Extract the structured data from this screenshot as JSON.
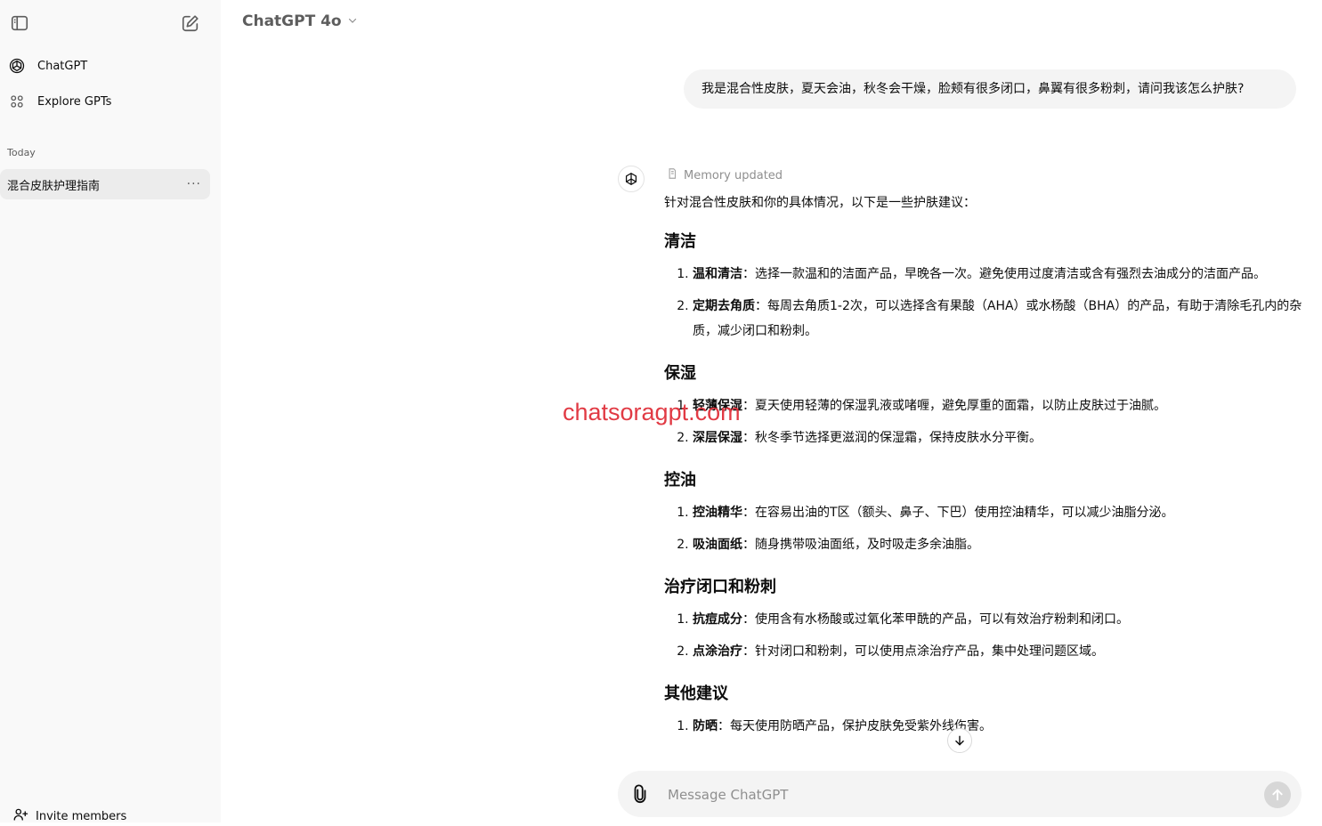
{
  "sidebar": {
    "toggle_icon": "sidebar-toggle-icon",
    "new_chat_icon": "new-chat-icon",
    "nav": [
      {
        "label": "ChatGPT",
        "icon": "openai-logo-icon"
      },
      {
        "label": "Explore GPTs",
        "icon": "grid-icon"
      }
    ],
    "section": "Today",
    "history": [
      {
        "title": "混合皮肤护理指南",
        "menu": "···"
      }
    ],
    "invite": "Invite members"
  },
  "header": {
    "model": "ChatGPT 4o"
  },
  "conversation": {
    "user_message": "我是混合性皮肤，夏天会油，秋冬会干燥，脸颊有很多闭口，鼻翼有很多粉刺，请问我该怎么护肤?",
    "memory_status": "Memory updated",
    "intro": "针对混合性皮肤和你的具体情况，以下是一些护肤建议：",
    "sections": [
      {
        "heading": "清洁",
        "items": [
          {
            "term": "温和清洁",
            "text": "：选择一款温和的洁面产品，早晚各一次。避免使用过度清洁或含有强烈去油成分的洁面产品。"
          },
          {
            "term": "定期去角质",
            "text": "：每周去角质1-2次，可以选择含有果酸（AHA）或水杨酸（BHA）的产品，有助于清除毛孔内的杂质，减少闭口和粉刺。"
          }
        ]
      },
      {
        "heading": "保湿",
        "items": [
          {
            "term": "轻薄保湿",
            "text": "：夏天使用轻薄的保湿乳液或啫喱，避免厚重的面霜，以防止皮肤过于油腻。"
          },
          {
            "term": "深层保湿",
            "text": "：秋冬季节选择更滋润的保湿霜，保持皮肤水分平衡。"
          }
        ]
      },
      {
        "heading": "控油",
        "items": [
          {
            "term": "控油精华",
            "text": "：在容易出油的T区（额头、鼻子、下巴）使用控油精华，可以减少油脂分泌。"
          },
          {
            "term": "吸油面纸",
            "text": "：随身携带吸油面纸，及时吸走多余油脂。"
          }
        ]
      },
      {
        "heading": "治疗闭口和粉刺",
        "items": [
          {
            "term": "抗痘成分",
            "text": "：使用含有水杨酸或过氧化苯甲酰的产品，可以有效治疗粉刺和闭口。"
          },
          {
            "term": "点涂治疗",
            "text": "：针对闭口和粉刺，可以使用点涂治疗产品，集中处理问题区域。"
          }
        ]
      },
      {
        "heading": "其他建议",
        "items": [
          {
            "term": "防晒",
            "text": "：每天使用防晒产品，保护皮肤免受紫外线伤害。"
          }
        ]
      }
    ]
  },
  "composer": {
    "placeholder": "Message ChatGPT",
    "attach_icon": "paperclip-icon",
    "send_icon": "arrow-up-icon"
  },
  "watermark": "chatsoragpt.com",
  "colors": {
    "sidebar_bg": "#f9f9f9",
    "bubble_bg": "#f4f4f4",
    "active_item_bg": "#ececec",
    "watermark": "#e0303a"
  }
}
